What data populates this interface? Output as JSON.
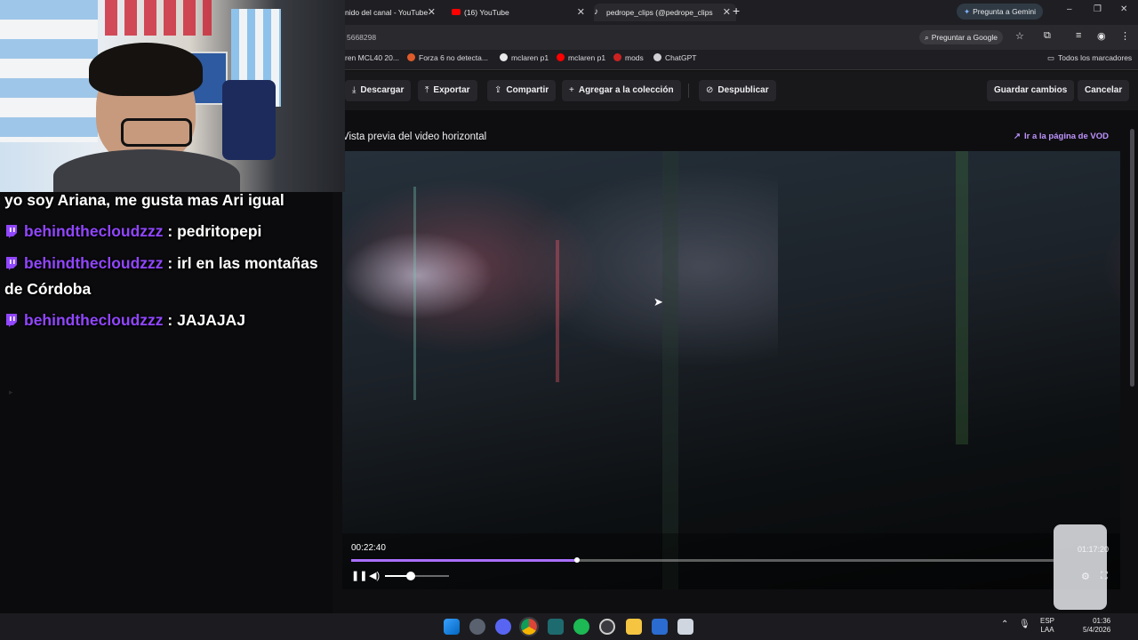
{
  "browser": {
    "tabs": [
      {
        "title": "nido del canal - YouTube"
      },
      {
        "title": "(16) YouTube"
      },
      {
        "title": "pedrope_clips (@pedrope_clips"
      }
    ],
    "new_tab_label": "+",
    "gemini_label": "Pregunta a Gemini",
    "url_fragment": "5668298",
    "ask_google_label": "Preguntar a Google",
    "bookmarks": [
      {
        "label": "ren MCL40 20...",
        "color": "#7a2a2a"
      },
      {
        "label": "Forza 6 no detecta...",
        "color": "#e05b2a"
      },
      {
        "label": "mclaren p1",
        "color": "#e8e8ea"
      },
      {
        "label": "mclaren p1",
        "color": "#ff0000"
      },
      {
        "label": "mods",
        "color": "#cc2222"
      },
      {
        "label": "ChatGPT",
        "color": "#cfcfd4"
      }
    ],
    "all_bookmarks_label": "Todos los marcadores"
  },
  "toolbar": {
    "download": "Descargar",
    "export": "Exportar",
    "share": "Compartir",
    "add_collection": "Agregar a la colección",
    "unpublish": "Despublicar",
    "save": "Guardar cambios",
    "cancel": "Cancelar"
  },
  "preview": {
    "title": "Vista previa del video horizontal",
    "vod_link": "Ir a la página de VOD"
  },
  "player": {
    "time": "00:22:40",
    "progress": 0.322,
    "volume": 0.4
  },
  "chat": [
    {
      "user": "",
      "message": "yo soy Ariana, me gusta mas Ari igual"
    },
    {
      "user": "behindthecloudzzz",
      "message": ": pedritopepi"
    },
    {
      "user": "behindthecloudzzz",
      "message": ": irl en las montañas"
    },
    {
      "user": "",
      "message": "de Córdoba"
    },
    {
      "user": "behindthecloudzzz",
      "message": ": JAJAJAJ"
    }
  ],
  "mini_player": {
    "time": "01:17:20"
  },
  "tray": {
    "lang_line1": "ESP",
    "lang_line2": "LAA",
    "clock_line1": "01:36",
    "clock_line2": "5/4/2026"
  },
  "colors": {
    "accent": "#a970ff",
    "link": "#bf94ff",
    "background": "#0e0e10"
  }
}
